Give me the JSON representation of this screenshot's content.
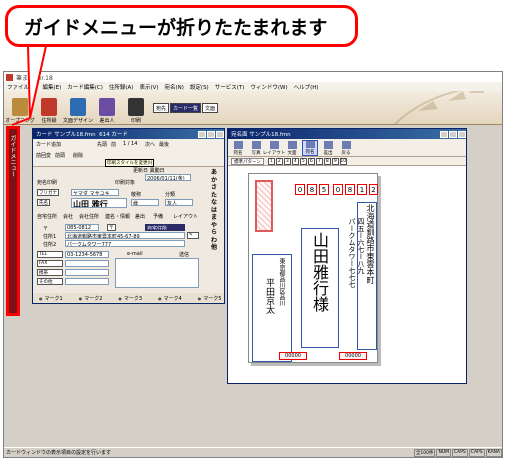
{
  "callout": {
    "text": "ガイドメニューが折りたたまれます"
  },
  "app": {
    "title": "筆まめVer.18",
    "menu": [
      "ファイル(F)",
      "編集(E)",
      "カード編集(C)",
      "住所録(A)",
      "表示(V)",
      "宛名(N)",
      "設定(S)",
      "サービス(T)",
      "ウィンドウ(W)",
      "ヘルプ(H)"
    ],
    "toolbar": [
      {
        "label": "オープニング",
        "icon": "opening-icon",
        "color": "#b98b3a"
      },
      {
        "label": "住所録",
        "icon": "address-book-icon",
        "color": "#c0392b"
      },
      {
        "label": "文面デザイン",
        "icon": "design-icon",
        "color": "#2d6cb0"
      },
      {
        "label": "差出人",
        "icon": "sender-icon",
        "color": "#6a4ca2"
      },
      {
        "label": "印刷",
        "icon": "print-icon",
        "color": "#333333"
      }
    ],
    "toolbar_small": [
      "宛先",
      "カード一覧",
      "文面"
    ],
    "side_tab": "ガイドメニュー"
  },
  "card_window": {
    "title": "カード  サンプル18.fmn",
    "count": "614 カード",
    "add_label": "カード追加",
    "tools": [
      "先頭",
      "前",
      "1 / 14",
      "次へ",
      "最後",
      "前回変",
      "前頭",
      "削除"
    ],
    "tooltip": "印刷スタイルを変更(I)",
    "date_label": "更新日 異動日",
    "date_value": "2006/01/11(金)",
    "kind_label": "宛名印刷",
    "print_label": "印刷対象",
    "furigana_label": "フリガナ",
    "furigana_value": "ヤマダ マサユキ",
    "name_label": "氏名",
    "name_value": "山田 雅行",
    "honorific_label": "敬称",
    "honorific_value": "様",
    "category_label": "分類",
    "category_value": "友人",
    "tabs_inner": [
      "自宅住所",
      "会社",
      "会社住所",
      "連名・情報",
      "差出",
      "予備",
      "レイアウト"
    ],
    "zip_label": "〒",
    "zip_value": "085-0812",
    "home_btn": "自宅住所",
    "addr1_label": "住所1",
    "addr1_value": "北海道釧路市東雲本町45-67-89",
    "addr2_label": "住所2",
    "addr2_value": "パークムタワー777",
    "tel_label": "TEL",
    "tel_value": "03-1234-5678",
    "fax_label": "FAX",
    "mobile_label": "携帯",
    "other_label": "その他",
    "email_label": "e-mail",
    "send_label": "送信",
    "kana": [
      "あ",
      "か",
      "さ",
      "た",
      "な",
      "は",
      "ま",
      "や",
      "ら",
      "わ",
      "他"
    ],
    "marks": [
      "マーク1",
      "マーク2",
      "マーク3",
      "マーク4",
      "マーク5"
    ]
  },
  "postcard_window": {
    "title": "宛名面  サンプル18.fmn",
    "tools": [
      "宛名",
      "写真",
      "レイアウト",
      "文面",
      "宛名",
      "差出",
      "戻る"
    ],
    "view_select": "標準パターン",
    "pages": [
      "1",
      "2",
      "3",
      "4",
      "5",
      "6",
      "7",
      "8",
      "9",
      "10"
    ],
    "zip_digits": [
      "0",
      "8",
      "5",
      "0",
      "8",
      "1",
      "2"
    ],
    "recipient_name": "山田雅行様",
    "address_line1": "北海道釧路市東雲本町",
    "address_line2": "四五ー六七ー八九",
    "address_line3": "パークムタワー七七七",
    "sender_address": "東京都品川区品川",
    "sender_name": "平田京太",
    "bottom_zip_left": "00000",
    "bottom_zip_right": "00000"
  },
  "statusbar": {
    "text": "カードウィンドウの表示項目の設定を行います",
    "right": [
      "全100件",
      "NUM",
      "CAPS",
      "CAPS",
      "KANA"
    ]
  }
}
